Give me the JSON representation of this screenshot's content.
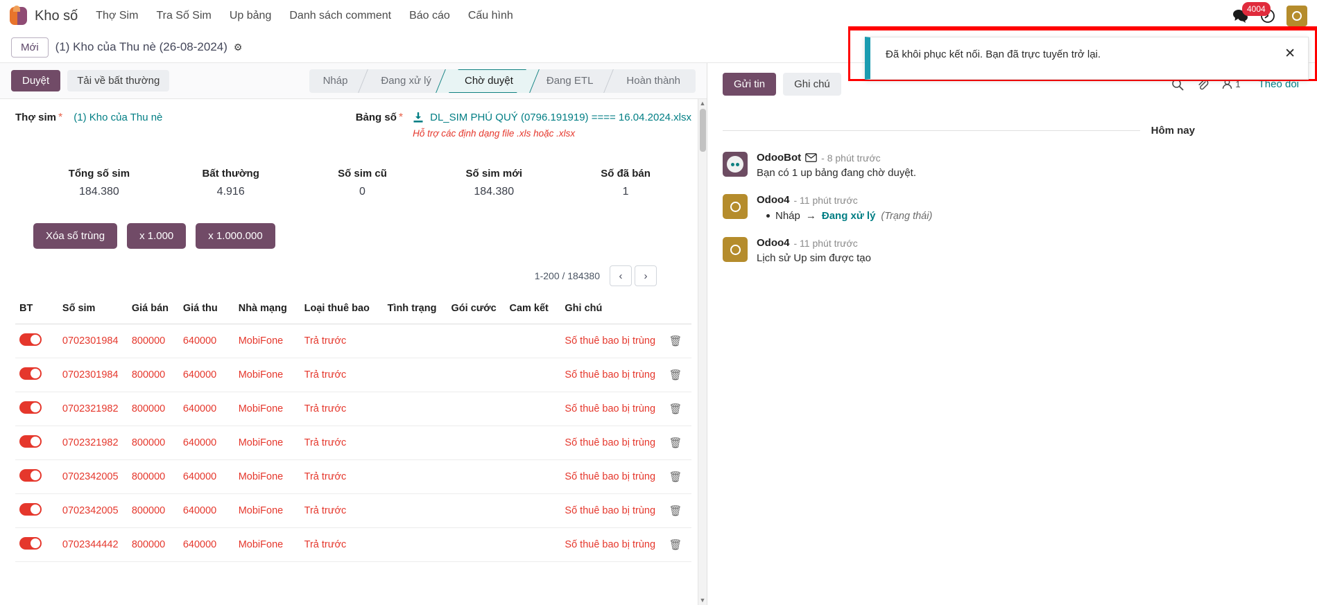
{
  "navbar": {
    "brand": "Kho số",
    "menu": [
      "Thợ Sim",
      "Tra Số Sim",
      "Up bảng",
      "Danh sách comment",
      "Báo cáo",
      "Cấu hình"
    ],
    "message_count": "4004",
    "avatar_initial": "O",
    "icons": {
      "messages": "chat-icon",
      "activities": "clock-icon"
    }
  },
  "breadcrumb": {
    "new_label": "Mới",
    "title": "(1) Kho của Thu nè (26-08-2024)",
    "gear": "gear-icon"
  },
  "actionbar": {
    "approve": "Duyệt",
    "download_abnormal": "Tải về bất thường",
    "statuses": [
      "Nháp",
      "Đang xử lý",
      "Chờ duyệt",
      "Đang ETL",
      "Hoàn thành"
    ],
    "active_status": "Chờ duyệt"
  },
  "form": {
    "tho_sim_label": "Thợ sim",
    "tho_sim_value": "(1) Kho của Thu nè",
    "bang_so_label": "Bảng số",
    "file_name": "DL_SIM PHÚ QUÝ (0796.191919) ==== 16.04.2024.xlsx",
    "file_hint": "Hỗ trợ các định dạng file .xls hoặc .xlsx"
  },
  "stats": [
    {
      "key": "Tổng số sim",
      "value": "184.380"
    },
    {
      "key": "Bất thường",
      "value": "4.916"
    },
    {
      "key": "Số sim cũ",
      "value": "0"
    },
    {
      "key": "Số sim mới",
      "value": "184.380"
    },
    {
      "key": "Số đã bán",
      "value": "1"
    }
  ],
  "tools": {
    "dedupe": "Xóa số trùng",
    "x1000": "x 1.000",
    "x1000000": "x 1.000.000"
  },
  "pager": {
    "range": "1-200 / 184380",
    "prev": "‹",
    "next": "›"
  },
  "table": {
    "headers": [
      "BT",
      "Số sim",
      "Giá bán",
      "Giá thu",
      "Nhà mạng",
      "Loại thuê bao",
      "Tình trạng",
      "Gói cước",
      "Cam kết",
      "Ghi chú"
    ],
    "rows": [
      {
        "sim": "0702301984",
        "gia_ban": "800000",
        "gia_thu": "640000",
        "nha_mang": "MobiFone",
        "loai": "Trả trước",
        "tinh_trang": "",
        "goi_cuoc": "",
        "cam_ket": "",
        "ghi_chu": "Số thuê bao bị trùng"
      },
      {
        "sim": "0702301984",
        "gia_ban": "800000",
        "gia_thu": "640000",
        "nha_mang": "MobiFone",
        "loai": "Trả trước",
        "tinh_trang": "",
        "goi_cuoc": "",
        "cam_ket": "",
        "ghi_chu": "Số thuê bao bị trùng"
      },
      {
        "sim": "0702321982",
        "gia_ban": "800000",
        "gia_thu": "640000",
        "nha_mang": "MobiFone",
        "loai": "Trả trước",
        "tinh_trang": "",
        "goi_cuoc": "",
        "cam_ket": "",
        "ghi_chu": "Số thuê bao bị trùng"
      },
      {
        "sim": "0702321982",
        "gia_ban": "800000",
        "gia_thu": "640000",
        "nha_mang": "MobiFone",
        "loai": "Trả trước",
        "tinh_trang": "",
        "goi_cuoc": "",
        "cam_ket": "",
        "ghi_chu": "Số thuê bao bị trùng"
      },
      {
        "sim": "0702342005",
        "gia_ban": "800000",
        "gia_thu": "640000",
        "nha_mang": "MobiFone",
        "loai": "Trả trước",
        "tinh_trang": "",
        "goi_cuoc": "",
        "cam_ket": "",
        "ghi_chu": "Số thuê bao bị trùng"
      },
      {
        "sim": "0702342005",
        "gia_ban": "800000",
        "gia_thu": "640000",
        "nha_mang": "MobiFone",
        "loai": "Trả trước",
        "tinh_trang": "",
        "goi_cuoc": "",
        "cam_ket": "",
        "ghi_chu": "Số thuê bao bị trùng"
      },
      {
        "sim": "0702344442",
        "gia_ban": "800000",
        "gia_thu": "640000",
        "nha_mang": "MobiFone",
        "loai": "Trả trước",
        "tinh_trang": "",
        "goi_cuoc": "",
        "cam_ket": "",
        "ghi_chu": "Số thuê bao bị trùng"
      }
    ]
  },
  "chatter": {
    "send_label": "Gửi tin",
    "note_label": "Ghi chú",
    "follower_count": "1",
    "follow_label": "Theo dõi",
    "day_separator": "Hôm nay",
    "messages": [
      {
        "author": "OdooBot",
        "time": "- 8 phút trước",
        "avatar": "bot",
        "text": "Bạn có 1 up bảng đang chờ duyệt.",
        "tracking": null
      },
      {
        "author": "Odoo4",
        "time": "- 11 phút trước",
        "avatar": "user",
        "text": "",
        "tracking": {
          "from": "Nháp",
          "arrow": "→",
          "to": "Đang xử lý",
          "field": "(Trạng thái)"
        }
      },
      {
        "author": "Odoo4",
        "time": "- 11 phút trước",
        "avatar": "user",
        "text": "Lịch sử Up sim được tạo",
        "tracking": null
      }
    ]
  },
  "toast": {
    "message": "Đã khôi phục kết nối. Bạn đã trực tuyến trở lại.",
    "close": "✕"
  },
  "colors": {
    "brand_purple": "#714b67",
    "teal": "#017e84",
    "danger_red": "#e5372c",
    "badge_red": "#e02b3c",
    "toast_accent": "#1a9bb0",
    "highlight_outline": "#ff0000"
  }
}
